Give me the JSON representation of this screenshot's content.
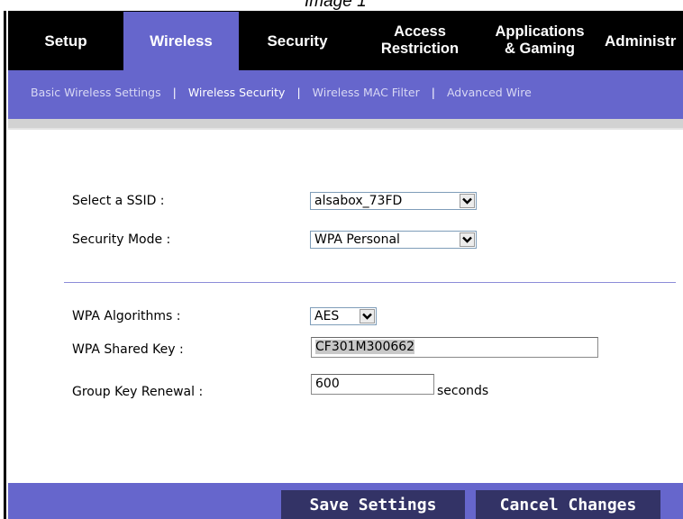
{
  "caption": "Image 1",
  "nav": {
    "tabs": [
      {
        "label": "Setup",
        "active": false
      },
      {
        "label": "Wireless",
        "active": true
      },
      {
        "label": "Security",
        "active": false
      },
      {
        "label_line1": "Access",
        "label_line2": "Restriction",
        "active": false
      },
      {
        "label_line1": "Applications",
        "label_line2": "& Gaming",
        "active": false
      },
      {
        "label": "Administr",
        "active": false
      }
    ]
  },
  "subnav": {
    "items": [
      {
        "label": "Basic Wireless Settings",
        "current": false
      },
      {
        "label": "Wireless Security",
        "current": true
      },
      {
        "label": "Wireless MAC Filter",
        "current": false
      },
      {
        "label": "Advanced Wire",
        "current": false
      }
    ],
    "separator": "|"
  },
  "form": {
    "ssid": {
      "label": "Select a SSID :",
      "value": "alsabox_73FD"
    },
    "security_mode": {
      "label": "Security Mode :",
      "value": "WPA Personal"
    },
    "wpa_algorithms": {
      "label": "WPA Algorithms :",
      "value": "AES"
    },
    "wpa_shared_key": {
      "label": "WPA Shared Key :",
      "value": "CF301M300662"
    },
    "group_key_renewal": {
      "label": "Group Key Renewal :",
      "value": "600",
      "unit": "seconds"
    }
  },
  "buttons": {
    "save": "Save Settings",
    "cancel": "Cancel Changes"
  },
  "colors": {
    "accent": "#6666cc",
    "button": "#333366",
    "nav_background": "#000000"
  }
}
